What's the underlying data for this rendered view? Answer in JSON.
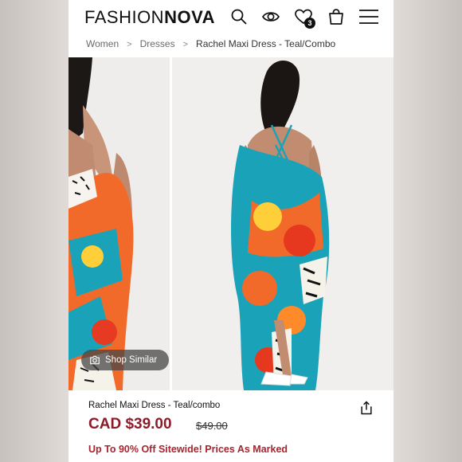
{
  "header": {
    "logo_part1": "FASHION",
    "logo_part2": "NOVA",
    "icons": [
      "search-icon",
      "eye-icon",
      "heart-icon",
      "bag-icon",
      "menu-icon"
    ],
    "wishlist_count": "3"
  },
  "breadcrumb": {
    "items": [
      "Women",
      "Dresses",
      "Rachel Maxi Dress - Teal/Combo"
    ],
    "separator": ">"
  },
  "gallery": {
    "shop_similar_label": "Shop Similar"
  },
  "product": {
    "title": "Rachel Maxi Dress - Teal/combo",
    "price": "CAD $39.00",
    "old_price": "$49.00",
    "promo": "Up To 90% Off Sitewide! Prices As Marked"
  },
  "colors": {
    "price": "#8c1c2a",
    "promo": "#a8242f",
    "dress_orange": "#f26a2a",
    "dress_teal": "#1aa3b8"
  }
}
